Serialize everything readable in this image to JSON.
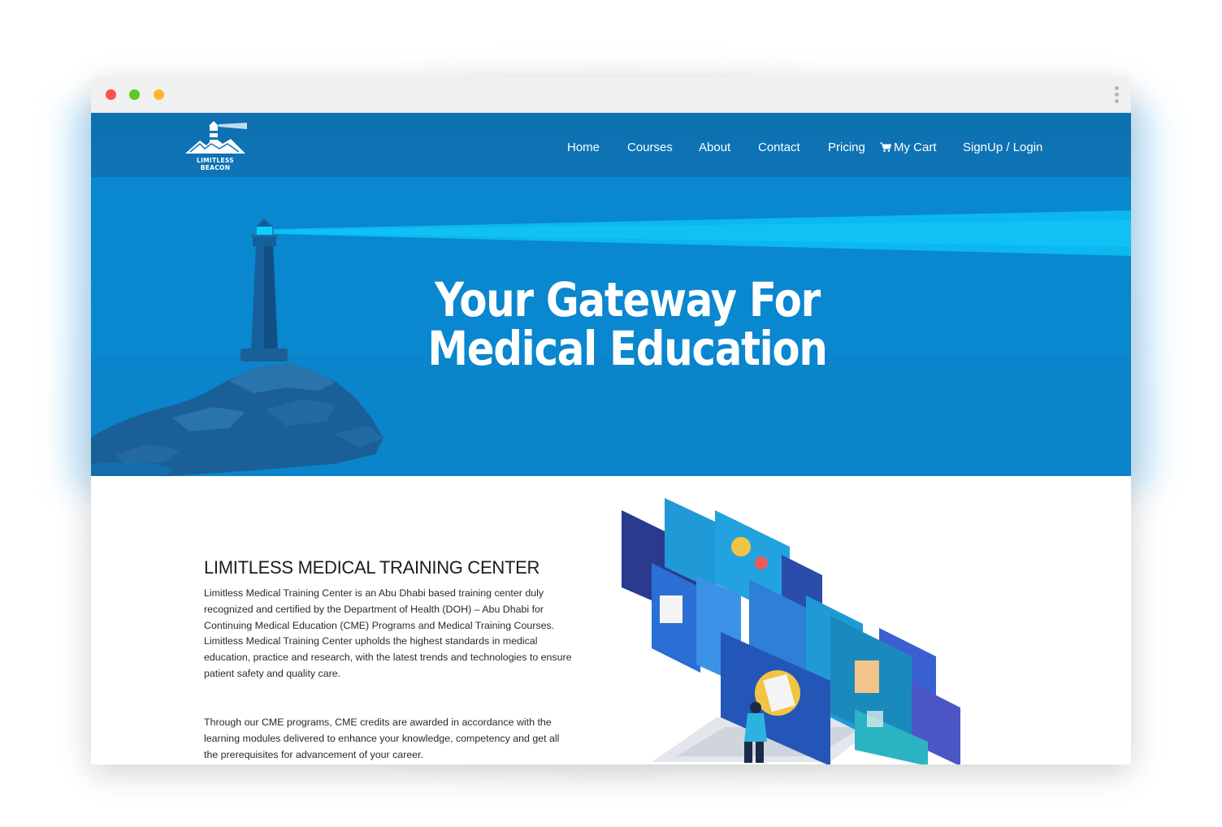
{
  "brand": {
    "logo_text": "LIMITLESS BEACON"
  },
  "nav": {
    "items": [
      {
        "label": "Home"
      },
      {
        "label": "Courses"
      },
      {
        "label": "About"
      },
      {
        "label": "Contact"
      },
      {
        "label": "Pricing"
      }
    ],
    "cart_label": "My Cart",
    "cart_icon": "shopping-cart-icon",
    "login_label": "SignUp / Login"
  },
  "hero": {
    "title_line1": "Your Gateway For",
    "title_line2": "Medical Education"
  },
  "about": {
    "title": "LIMITLESS MEDICAL TRAINING CENTER",
    "paragraph1": "Limitless Medical Training Center is an Abu Dhabi based training center duly recognized and certified by the Department of Health (DOH) – Abu Dhabi for Continuing Medical Education (CME) Programs and Medical Training Courses. Limitless Medical Training Center upholds the highest standards in medical education, practice and research, with the latest trends and technologies to ensure patient safety and quality care.",
    "paragraph2": "Through our CME programs, CME credits are awarded in accordance with the learning modules delivered to enhance your knowledge, competency and get all the prerequisites for advancement of your career."
  },
  "colors": {
    "hero_blue": "#0987cf",
    "nav_blue": "#0f74b6",
    "beam": "#0bb8f0",
    "lighthouse": "#155f9b"
  }
}
